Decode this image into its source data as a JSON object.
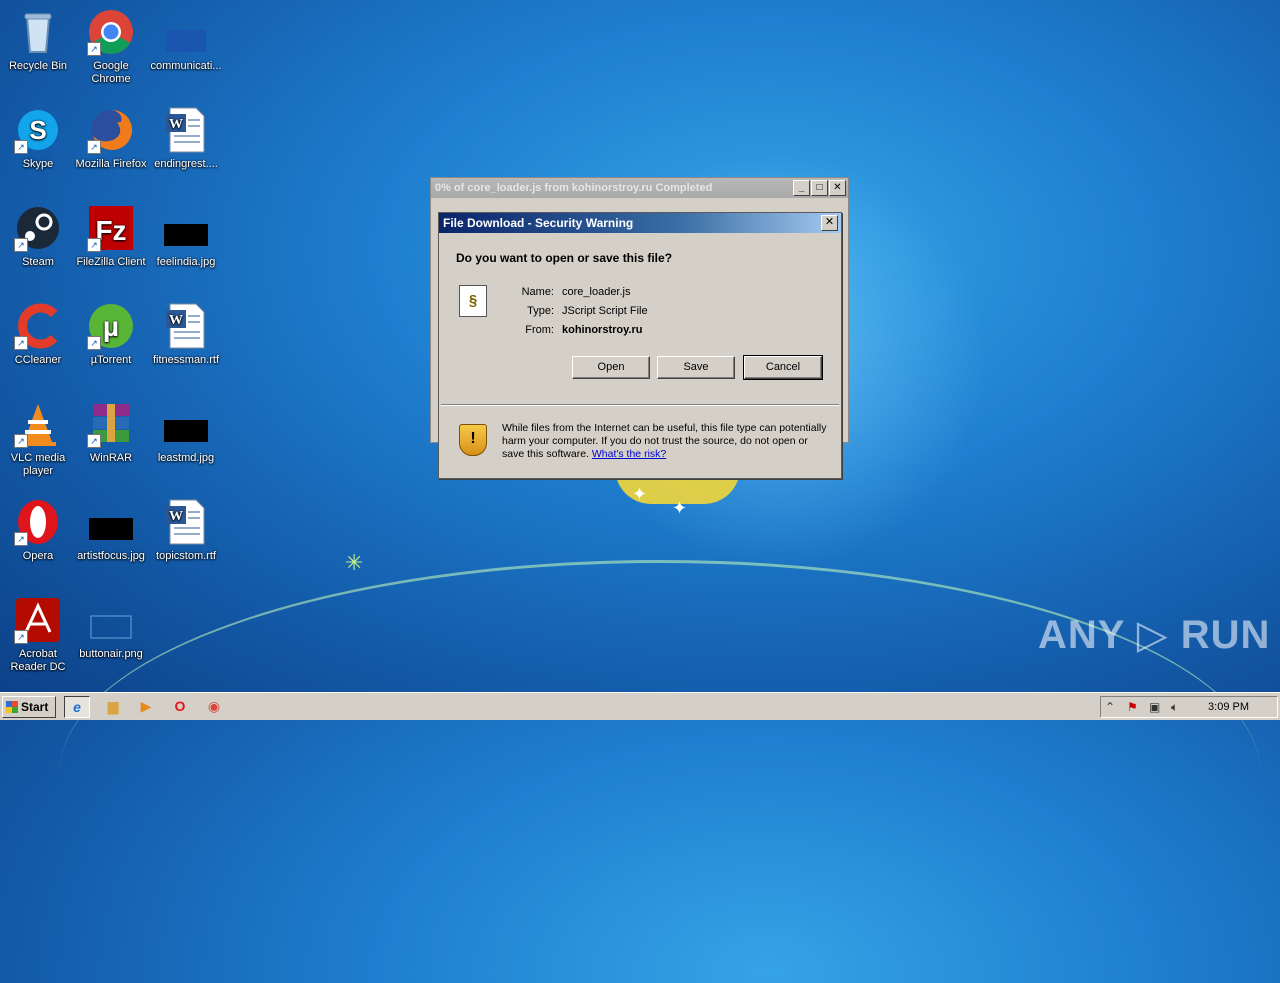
{
  "desktop": {
    "icons": [
      {
        "label": "Recycle Bin",
        "icon": "recycle-bin-icon"
      },
      {
        "label": "Google Chrome",
        "icon": "chrome-icon"
      },
      {
        "label": "communicati...",
        "icon": "file-icon"
      },
      {
        "label": "Skype",
        "icon": "skype-icon"
      },
      {
        "label": "Mozilla Firefox",
        "icon": "firefox-icon"
      },
      {
        "label": "endingrest....",
        "icon": "word-doc-icon"
      },
      {
        "label": "Steam",
        "icon": "steam-icon"
      },
      {
        "label": "FileZilla Client",
        "icon": "filezilla-icon"
      },
      {
        "label": "feelindia.jpg",
        "icon": "image-file-icon"
      },
      {
        "label": "CCleaner",
        "icon": "ccleaner-icon"
      },
      {
        "label": "µTorrent",
        "icon": "utorrent-icon"
      },
      {
        "label": "fitnessman.rtf",
        "icon": "word-doc-icon"
      },
      {
        "label": "VLC media player",
        "icon": "vlc-icon"
      },
      {
        "label": "WinRAR",
        "icon": "winrar-icon"
      },
      {
        "label": "leastmd.jpg",
        "icon": "image-file-icon"
      },
      {
        "label": "Opera",
        "icon": "opera-icon"
      },
      {
        "label": "artistfocus.jpg",
        "icon": "image-file-icon"
      },
      {
        "label": "topicstom.rtf",
        "icon": "word-doc-icon"
      },
      {
        "label": "Acrobat Reader DC",
        "icon": "acrobat-icon"
      },
      {
        "label": "buttonair.png",
        "icon": "image-file-icon"
      }
    ]
  },
  "progress_window": {
    "title": "0% of core_loader.js from kohinorstroy.ru Completed",
    "buttons": {
      "minimize": "_",
      "maximize": "□",
      "close": "✕"
    }
  },
  "dialog": {
    "title": "File Download - Security Warning",
    "close": "✕",
    "question": "Do you want to open or save this file?",
    "name_label": "Name:",
    "name_value": "core_loader.js",
    "type_label": "Type:",
    "type_value": "JScript Script File",
    "from_label": "From:",
    "from_value": "kohinorstroy.ru",
    "open_label": "Open",
    "save_label": "Save",
    "cancel_label": "Cancel",
    "warning_text": "While files from the Internet can be useful, this file type can potentially harm your computer. If you do not trust the source, do not open or save this software. ",
    "warning_link": "What's the risk?"
  },
  "taskbar": {
    "start_label": "Start",
    "apps": [
      "internet-explorer-icon",
      "folder-icon",
      "media-player-icon",
      "opera-icon",
      "chrome-icon"
    ],
    "clock": "3:09 PM"
  },
  "watermark": "ANY ▷ RUN"
}
